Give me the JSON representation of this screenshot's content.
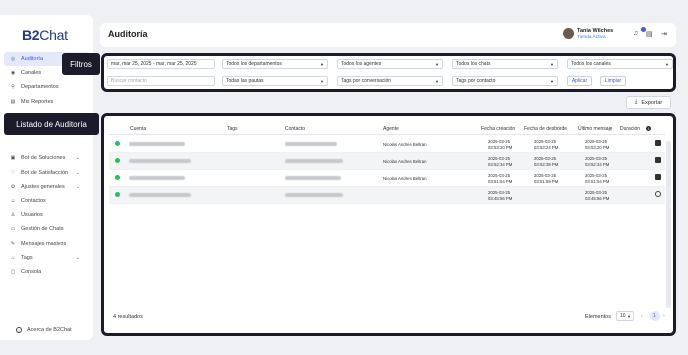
{
  "app": {
    "logo": "B2Chat"
  },
  "sidebar": {
    "items": [
      {
        "label": "Auditoría",
        "icon": "audit-icon",
        "active": true
      },
      {
        "label": "Canales",
        "icon": "channels-icon"
      },
      {
        "label": "Departamentos",
        "icon": "departments-icon"
      },
      {
        "label": "Mis Reportes",
        "icon": "reports-icon"
      },
      {
        "label": "Bot de Soluciones",
        "icon": "bot-icon",
        "chevron": true
      },
      {
        "label": "Bot de Satisfacción",
        "icon": "satisfaction-icon",
        "chevron": true
      },
      {
        "label": "Ajustes generales",
        "icon": "settings-icon",
        "chevron": true
      },
      {
        "label": "Contactos",
        "icon": "contacts-icon"
      },
      {
        "label": "Usuarios",
        "icon": "users-icon"
      },
      {
        "label": "Gestión de Chats",
        "icon": "chats-icon"
      },
      {
        "label": "Mensajes masivos",
        "icon": "broadcast-icon"
      },
      {
        "label": "Tags",
        "icon": "tag-icon",
        "chevron": true
      },
      {
        "label": "Consola",
        "icon": "console-icon"
      }
    ],
    "about": "Acerca de B2Chat"
  },
  "header": {
    "title": "Auditoría",
    "user_name": "Tania Wilches",
    "user_status": "Tienda Activa"
  },
  "callouts": {
    "filters": "Filtros",
    "table": "Listado de Auditoría"
  },
  "filters": {
    "date_range": "mar, mar 25, 2025 - mar, mar 25, 2025",
    "departments": "Todos los departamentos",
    "agents": "Todos los agentes",
    "chats": "Todos los chats",
    "channels": "Todos los canales",
    "contact_placeholder": "Buscar contacto",
    "guidelines": "Todas las pautas",
    "per_conversation": "Tags por conversación",
    "per_contact": "Tags por contacto",
    "apply": "Aplicar",
    "clear": "Limpiar"
  },
  "export_label": "Exportar",
  "table": {
    "headers": [
      "Cuenta",
      "Tags",
      "Contacto",
      "Agente",
      "Fecha creación",
      "Fecha de desborde",
      "Último mensaje",
      "Duración"
    ],
    "rows": [
      {
        "agent": "Nicolas Andres Beltran",
        "created": "2025-03-25",
        "created_time": "03:53:20 PM",
        "overflow": "2025-03-25",
        "overflow_time": "03:53:24 PM",
        "last": "2025-03-25",
        "last_time": "03:53:20 PM"
      },
      {
        "agent": "Nicolas Andres Beltran",
        "created": "2025-03-25",
        "created_time": "03:52:34 PM",
        "overflow": "2025-03-25",
        "overflow_time": "03:52:38 PM",
        "last": "2025-03-25",
        "last_time": "03:52:34 PM"
      },
      {
        "agent": "Nicolas Andres Beltran",
        "created": "2025-03-25",
        "created_time": "03:51:54 PM",
        "overflow": "2025-03-25",
        "overflow_time": "03:51:59 PM",
        "last": "2025-03-25",
        "last_time": "03:51:54 PM"
      },
      {
        "agent": "",
        "created": "2025-03-25",
        "created_time": "03:45:56 PM",
        "overflow": "",
        "overflow_time": "",
        "last": "2025-03-25",
        "last_time": "03:45:56 PM"
      }
    ]
  },
  "footer": {
    "results": "4 resultados",
    "elements_label": "Elementos",
    "per_page": "10",
    "page": "1"
  }
}
